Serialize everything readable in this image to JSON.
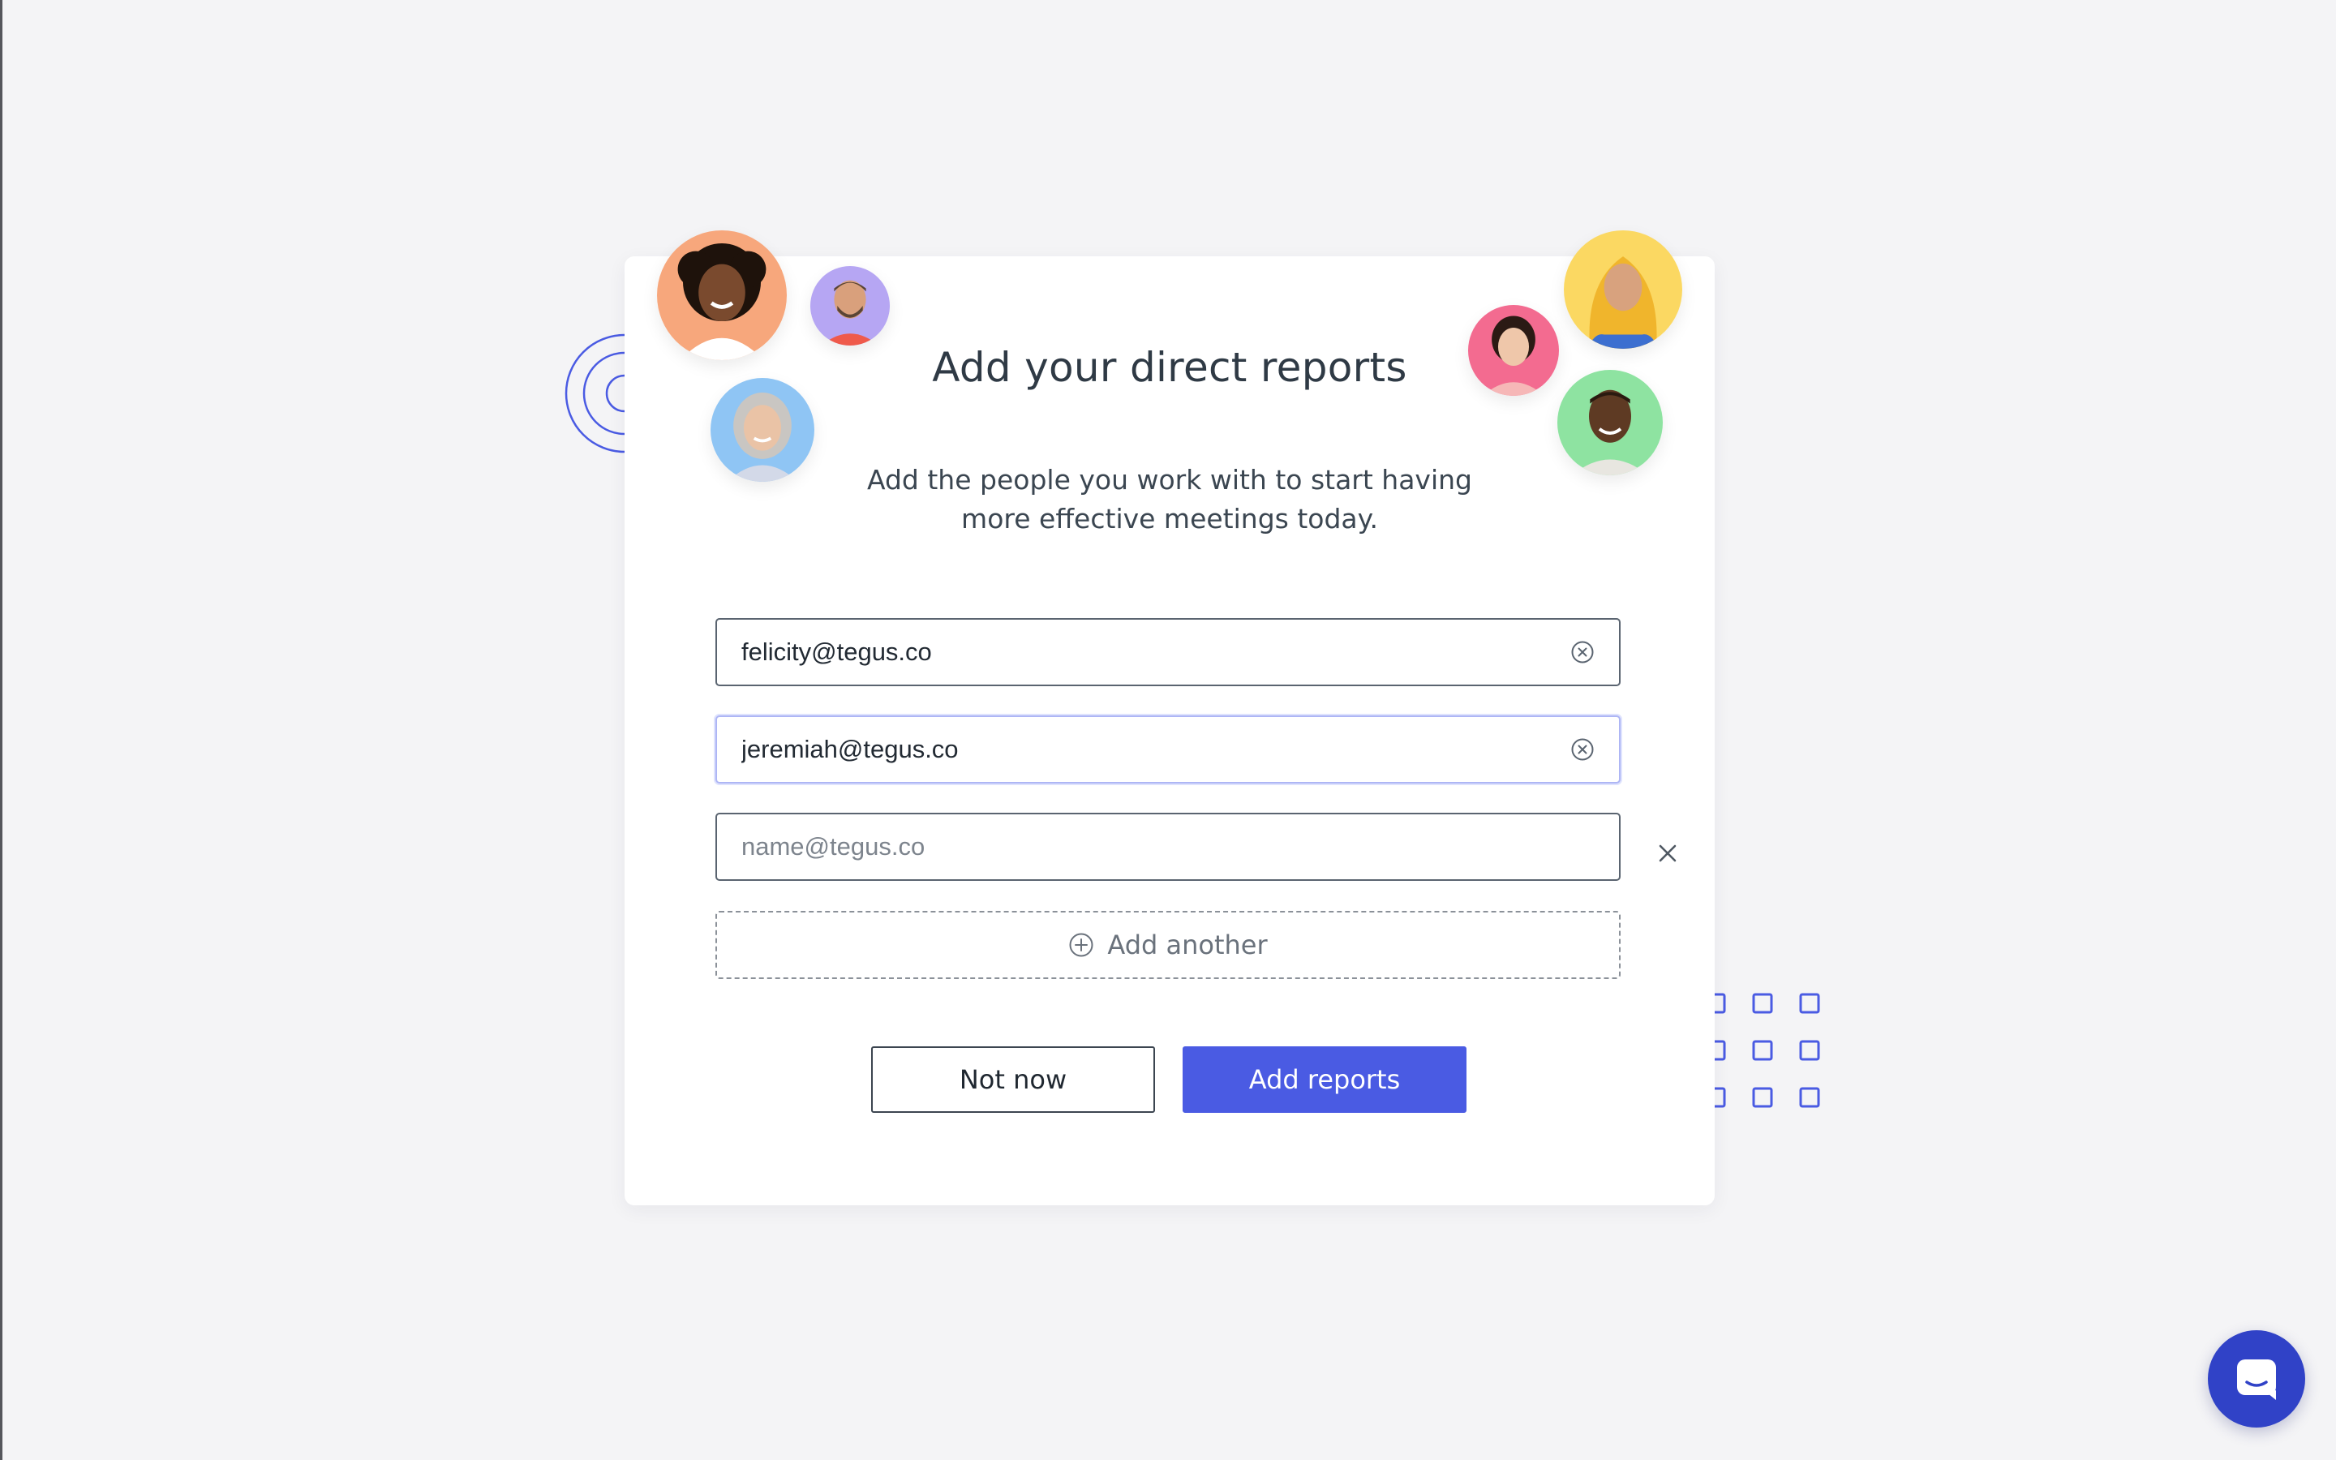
{
  "modal": {
    "title": "Add your direct reports",
    "subtitle_line1": "Add the people you work with to start having",
    "subtitle_line2": "more effective meetings today."
  },
  "fields": [
    {
      "value": "felicity@tegus.co",
      "placeholder": "name@tegus.co",
      "clear_icon": "circle-x-icon"
    },
    {
      "value": "jeremiah@tegus.co",
      "placeholder": "name@tegus.co",
      "clear_icon": "circle-x-icon",
      "focused": true
    },
    {
      "value": "",
      "placeholder": "name@tegus.co",
      "remove_icon": "close-icon"
    }
  ],
  "add_another": {
    "label": "Add another",
    "icon": "plus-circle-icon"
  },
  "actions": {
    "secondary_label": "Not now",
    "primary_label": "Add reports"
  },
  "colors": {
    "page_background": "#f4f4f6",
    "primary": "#4a5be3",
    "chat_launcher": "#3042c7",
    "title_text": "#2f3a45",
    "avatar_backgrounds": [
      "#f7a77c",
      "#b6a6f3",
      "#8fc5f4",
      "#f36b90",
      "#fbd862",
      "#8ee3a1"
    ]
  },
  "avatars": [
    {
      "name": "avatar-woman-curly-hair",
      "bg": "#f7a77c",
      "skin": "#7a4a2e",
      "hair": "#1e120b",
      "shirt": "#ffffff"
    },
    {
      "name": "avatar-man-beard",
      "bg": "#b6a6f3",
      "skin": "#d9a07c",
      "hair": "#5a4535",
      "shirt": "#ef5a4b"
    },
    {
      "name": "avatar-woman-gray-hair",
      "bg": "#8fc5f4",
      "skin": "#eac3a6",
      "hair": "#c9c6c2",
      "shirt": "#d3d9e8"
    },
    {
      "name": "avatar-woman-dark-hair",
      "bg": "#f36b90",
      "skin": "#efc7aa",
      "hair": "#2b1a14",
      "shirt": "#f6b7b7"
    },
    {
      "name": "avatar-woman-hijab",
      "bg": "#fbd862",
      "skin": "#d8a27e",
      "hair": "#f0b52c",
      "shirt": "#3c6fd0"
    },
    {
      "name": "avatar-man-smiling",
      "bg": "#8ee3a1",
      "skin": "#5e3a23",
      "hair": "#2a1a10",
      "shirt": "#e8e6e0"
    }
  ],
  "decorations": {
    "arcs_icon": "concentric-arcs-decoration",
    "grid_icon": "square-grid-decoration"
  },
  "chat": {
    "icon": "chat-bubble-icon"
  }
}
